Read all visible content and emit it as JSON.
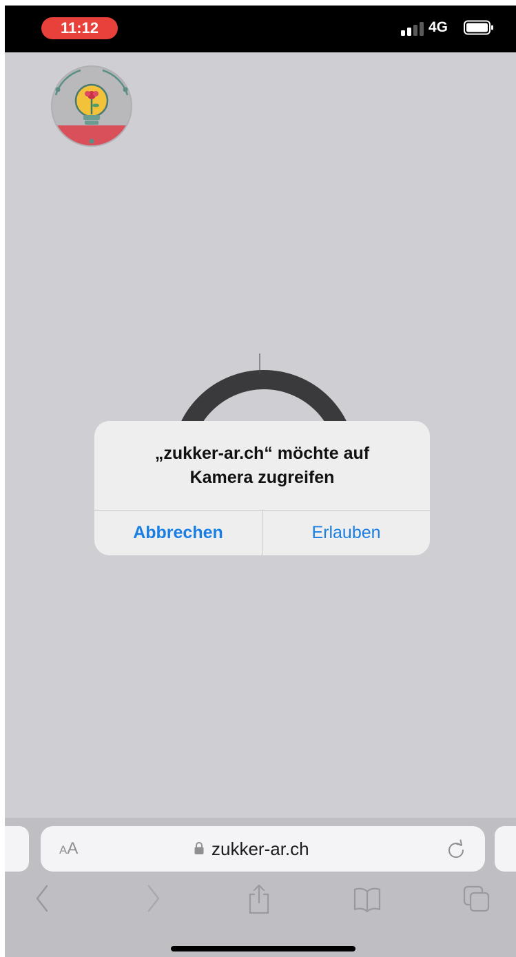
{
  "status_bar": {
    "time": "11:12",
    "network": "4G"
  },
  "alert": {
    "title_line1": "„zukker-ar.ch“ möchte auf",
    "title_line2": "Kamera zugreifen",
    "cancel_label": "Abbrechen",
    "allow_label": "Erlauben"
  },
  "browser": {
    "text_size_small": "A",
    "text_size_big": "A",
    "url": "zukker-ar.ch"
  },
  "icons": {
    "back": "chevron-left-icon",
    "forward": "chevron-right-icon",
    "share": "share-icon",
    "bookmarks": "book-icon",
    "tabs": "tabs-icon",
    "lock": "lock-icon",
    "reload": "reload-icon"
  },
  "colors": {
    "time_pill": "#e8403a",
    "alert_button": "#1a7ee3",
    "page_background": "#cfced2"
  }
}
